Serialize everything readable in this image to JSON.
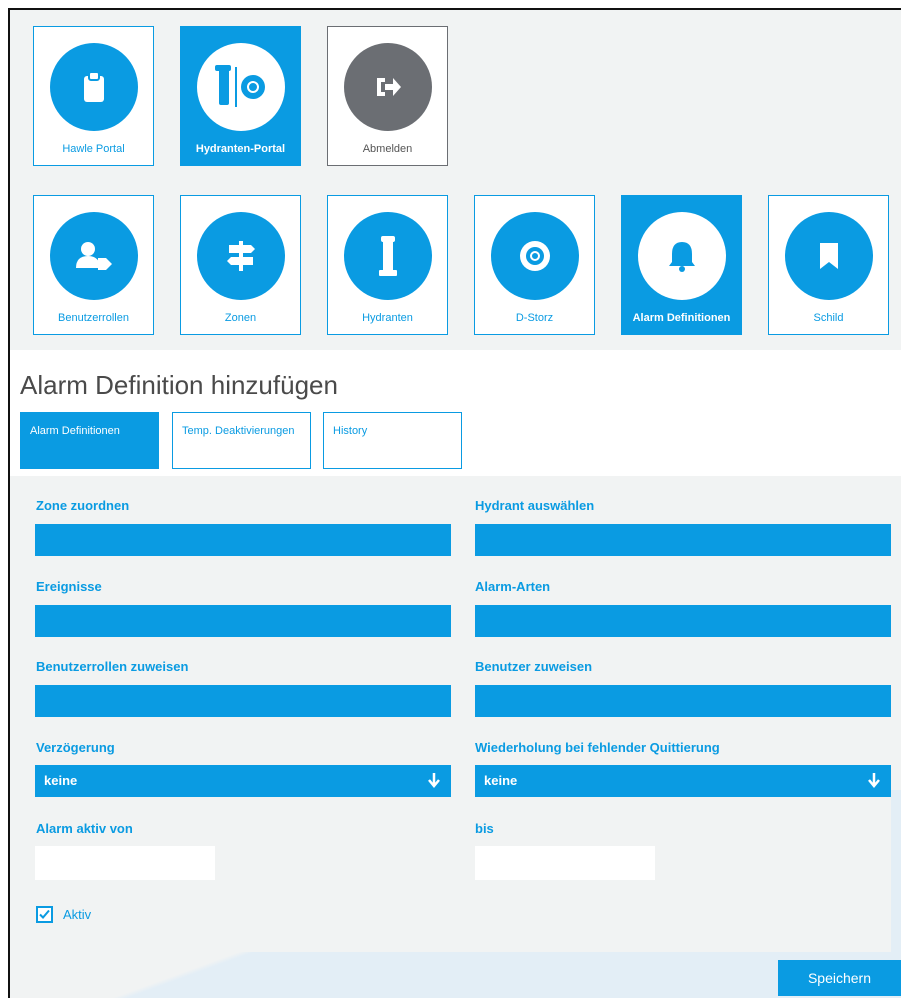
{
  "top_tiles": [
    {
      "label": "Hawle Portal",
      "icon": "clipboard-icon"
    },
    {
      "label": "Hydranten-Portal",
      "icon": "hydrant-portal-icon"
    },
    {
      "label": "Abmelden",
      "icon": "logout-icon"
    }
  ],
  "nav_tiles": [
    {
      "label": "Benutzerrollen",
      "icon": "user-tag-icon"
    },
    {
      "label": "Zonen",
      "icon": "signpost-icon"
    },
    {
      "label": "Hydranten",
      "icon": "hydrant-icon"
    },
    {
      "label": "D-Storz",
      "icon": "coupling-icon"
    },
    {
      "label": "Alarm Definitionen",
      "icon": "bell-icon"
    },
    {
      "label": "Schild",
      "icon": "bookmark-icon"
    }
  ],
  "page_title": "Alarm Definition hinzufügen",
  "tabs": [
    {
      "label": "Alarm Definitionen"
    },
    {
      "label": "Temp. Deaktivierungen"
    },
    {
      "label": "History"
    }
  ],
  "form": {
    "zone_label": "Zone zuordnen",
    "hydrant_label": "Hydrant auswählen",
    "events_label": "Ereignisse",
    "alarm_types_label": "Alarm-Arten",
    "roles_label": "Benutzerrollen zuweisen",
    "users_label": "Benutzer zuweisen",
    "delay_label": "Verzögerung",
    "delay_value": "keine",
    "repeat_label": "Wiederholung bei fehlender Quittierung",
    "repeat_value": "keine",
    "active_from_label": "Alarm aktiv von",
    "until_label": "bis",
    "active_checkbox_label": "Aktiv",
    "active_checked": true
  },
  "save_button": "Speichern",
  "colors": {
    "accent": "#0a9be2",
    "dark_tile": "#6b6e73",
    "panel": "#f1f3f3"
  }
}
